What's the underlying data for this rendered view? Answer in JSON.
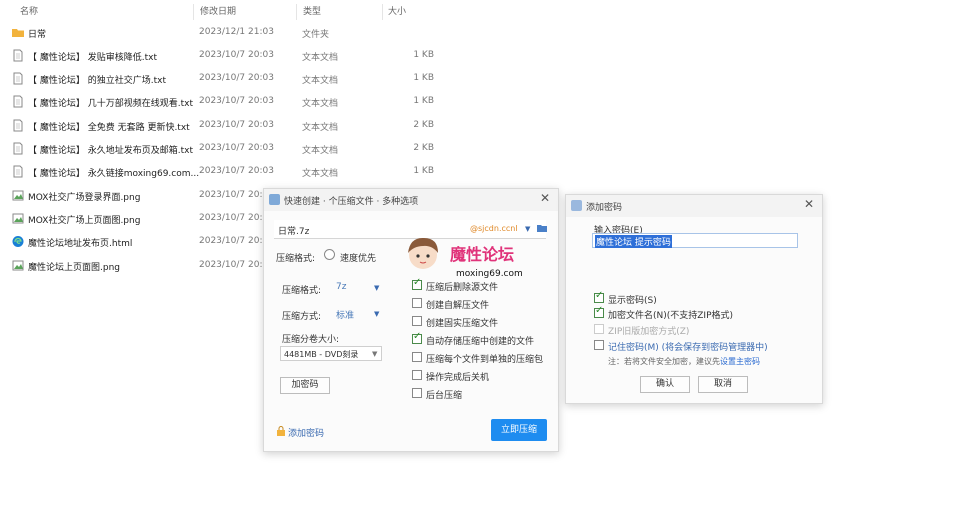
{
  "list": {
    "headers": {
      "name": "名称",
      "date": "修改日期",
      "type": "类型",
      "size": "大小"
    },
    "rows": [
      {
        "icon": "folder-icon",
        "name": "日常",
        "date": "2023/12/1 21:03",
        "type": "文件夹",
        "size": ""
      },
      {
        "icon": "text-file-icon",
        "name": "【 魔性论坛】 发贴审核降低.txt",
        "date": "2023/10/7 20:03",
        "type": "文本文档",
        "size": "1 KB"
      },
      {
        "icon": "text-file-icon",
        "name": "【 魔性论坛】 的独立社交广场.txt",
        "date": "2023/10/7 20:03",
        "type": "文本文档",
        "size": "1 KB"
      },
      {
        "icon": "text-file-icon",
        "name": "【 魔性论坛】 几十万部视频在线观看.txt",
        "date": "2023/10/7 20:03",
        "type": "文本文档",
        "size": "1 KB"
      },
      {
        "icon": "text-file-icon",
        "name": "【 魔性论坛】 全免费 无套路 更新快.txt",
        "date": "2023/10/7 20:03",
        "type": "文本文档",
        "size": "2 KB"
      },
      {
        "icon": "text-file-icon",
        "name": "【 魔性论坛】 永久地址发布页及邮箱.txt",
        "date": "2023/10/7 20:03",
        "type": "文本文档",
        "size": "2 KB"
      },
      {
        "icon": "text-file-icon",
        "name": "【 魔性论坛】 永久链接moxing69.com...",
        "date": "2023/10/7 20:03",
        "type": "文本文档",
        "size": "1 KB"
      },
      {
        "icon": "image-file-icon",
        "name": "MOX社交广场登录界面.png",
        "date": "2023/10/7 20:0",
        "type": "",
        "size": ""
      },
      {
        "icon": "image-file-icon",
        "name": "MOX社交广场上页面图.png",
        "date": "2023/10/7 20:0",
        "type": "",
        "size": ""
      },
      {
        "icon": "edge-browser-icon",
        "name": "魔性论坛地址发布页.html",
        "date": "2023/10/7 20:0",
        "type": "",
        "size": ""
      },
      {
        "icon": "image-file-icon",
        "name": "魔性论坛上页面图.png",
        "date": "2023/10/7 20:0",
        "type": "",
        "size": ""
      }
    ]
  },
  "archive": {
    "title": "快速创建 · 个压缩文件 · 多种选项",
    "path_value": "日常.7z",
    "path_hint": "@sjcdn.ccnl",
    "format_label": "压缩格式:",
    "format_value": "7z",
    "radio_label": "速度优先",
    "method_label": "压缩方式:",
    "method_value": "标准",
    "volume_label": "压缩分卷大小:",
    "volume_value": "4481MB - DVD刻录",
    "encrypt_btn": "加密码",
    "options": [
      {
        "label": "压缩后删除源文件",
        "checked": true
      },
      {
        "label": "创建自解压文件",
        "checked": false
      },
      {
        "label": "创建固实压缩文件",
        "checked": false
      },
      {
        "label": "自动存储压缩中创建的文件",
        "checked": true
      },
      {
        "label": "压缩每个文件到单独的压缩包",
        "checked": false
      },
      {
        "label": "操作完成后关机",
        "checked": false
      },
      {
        "label": "后台压缩",
        "checked": false
      }
    ],
    "add_password": "添加密码",
    "start_btn": "立即压缩"
  },
  "watermark": {
    "title": "魔性论坛",
    "url": "moxing69.com"
  },
  "password": {
    "title": "添加密码",
    "input_label": "输入密码(E)",
    "input_value": "魔性论坛 提示密码",
    "options": [
      {
        "label": "显示密码(S)",
        "checked": true
      },
      {
        "label": "加密文件名(N)(不支持ZIP格式)",
        "checked": true
      },
      {
        "label": "ZIP旧版加密方式(Z)",
        "checked": false
      },
      {
        "label": "记住密码(M) (将会保存到密码管理器中)",
        "checked": false
      }
    ],
    "note_prefix": "注：若将文件安全加密，建议先",
    "note_link": "设置主密码",
    "ok_btn": "确认",
    "cancel_btn": "取消"
  },
  "colors": {
    "accent": "#1e8cf0",
    "folder": "#f2b33d",
    "check": "#2e8b2e",
    "watermark": "#e0337a"
  }
}
